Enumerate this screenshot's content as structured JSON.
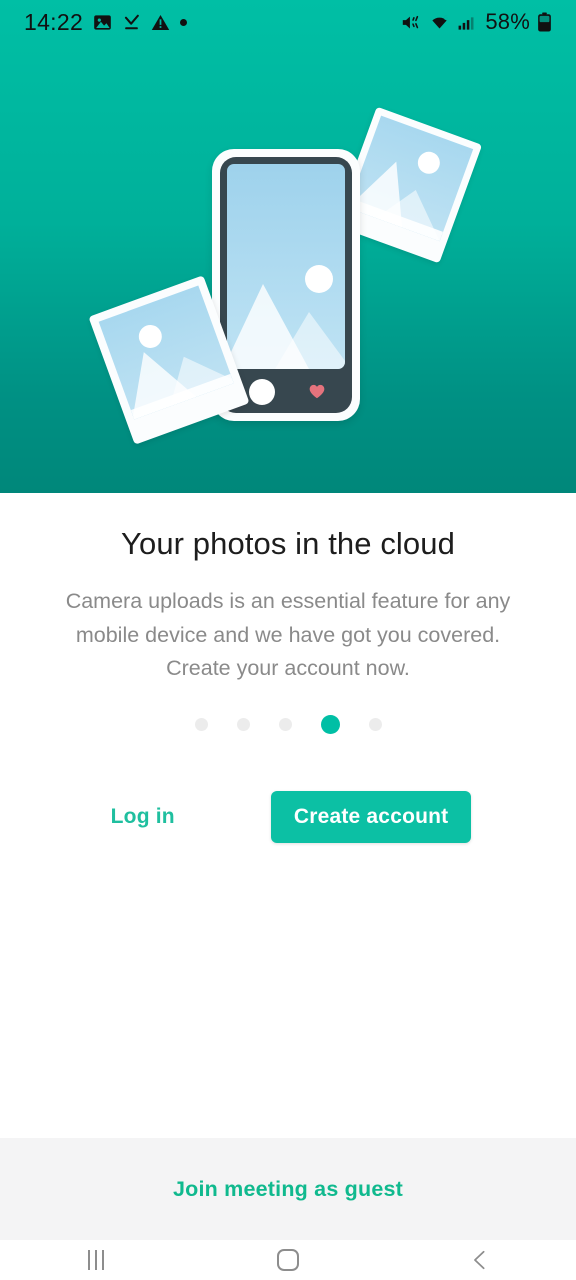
{
  "status_bar": {
    "time": "14:22",
    "battery_percent": "58%",
    "left_icons": [
      "image-icon",
      "download-complete-icon",
      "warning-triangle-icon",
      "dot-indicator-icon"
    ],
    "right_icons": [
      "mute-icon",
      "wifi-6-icon",
      "cellular-signal-icon",
      "battery-icon"
    ]
  },
  "hero": {
    "illustration_name": "photos-in-the-cloud-illustration",
    "gradient_top": "#00BFA5",
    "gradient_bottom": "#00877A",
    "phone_frame_color": "#37474F",
    "photo_sky_color": "#a8d8ef",
    "heart_color": "#E5737D"
  },
  "onboarding": {
    "title": "Your photos in the cloud",
    "body": "Camera uploads is an essential feature for any mobile device and we have got you covered. Create your account now.",
    "pager": {
      "total": 5,
      "active_index": 3,
      "active_color": "#00BFA5",
      "inactive_color": "#ececec"
    }
  },
  "actions": {
    "login_label": "Log in",
    "login_color": "#1FBF9F",
    "create_account_label": "Create account",
    "create_account_color": "#0CC0A4"
  },
  "guest_bar": {
    "label": "Join meeting as guest",
    "color": "#10B98E",
    "background": "#F4F4F5"
  },
  "navigation_bar": {
    "recents_label": "Recents",
    "home_label": "Home",
    "back_label": "Back"
  }
}
